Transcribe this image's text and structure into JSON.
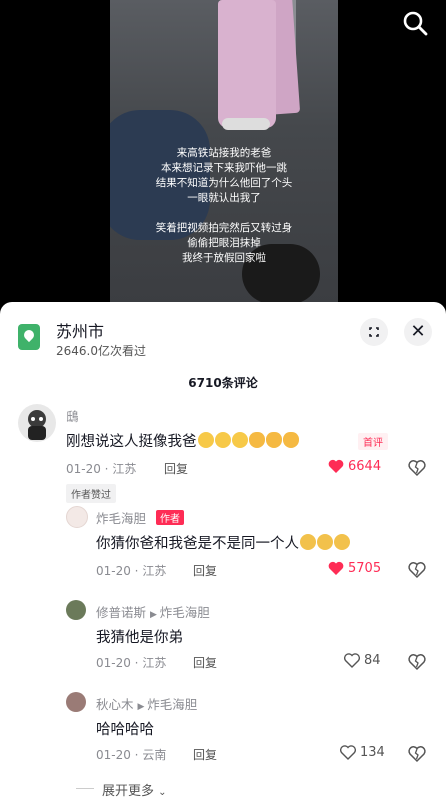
{
  "video": {
    "caption_lines": [
      "来高铁站接我的老爸",
      "本来想记录下来我吓他一跳",
      "结果不知道为什么他回了个头",
      "一眼就认出我了",
      "",
      "笑着把视频拍完然后又转过身",
      "偷偷把眼泪抹掉",
      "我终于放假回家啦"
    ]
  },
  "location": {
    "title": "苏州市",
    "views": "2646.0亿次看过"
  },
  "comments_count": "6710条评论",
  "comments": [
    {
      "name": "鴟",
      "text": "刚想说这人挺像我爸",
      "badge": "首评",
      "date": "01-20 · 江苏",
      "reply": "回复",
      "likes": "6644",
      "author_liked": "作者赞过"
    }
  ],
  "replies": [
    {
      "name": "炸毛海胆",
      "tag": "作者",
      "text": "你猜你爸和我爸是不是同一个人",
      "date": "01-20 · 江苏",
      "reply": "回复",
      "likes": "5705"
    },
    {
      "name": "修普诺斯",
      "to": "炸毛海胆",
      "text": "我猜他是你弟",
      "date": "01-20 · 江苏",
      "reply": "回复",
      "likes": "84"
    },
    {
      "name": "秋心木",
      "to": "炸毛海胆",
      "text": "哈哈哈哈",
      "date": "01-20 · 云南",
      "reply": "回复",
      "likes": "134"
    }
  ],
  "expand_more": "展开更多",
  "colors": {
    "accent": "#fe2c55",
    "location_green": "#3fb26a"
  },
  "icons": {
    "search": "search-icon",
    "share": "share-icon",
    "close": "close-icon",
    "heart": "heart-icon",
    "dislike": "dislike-icon"
  }
}
